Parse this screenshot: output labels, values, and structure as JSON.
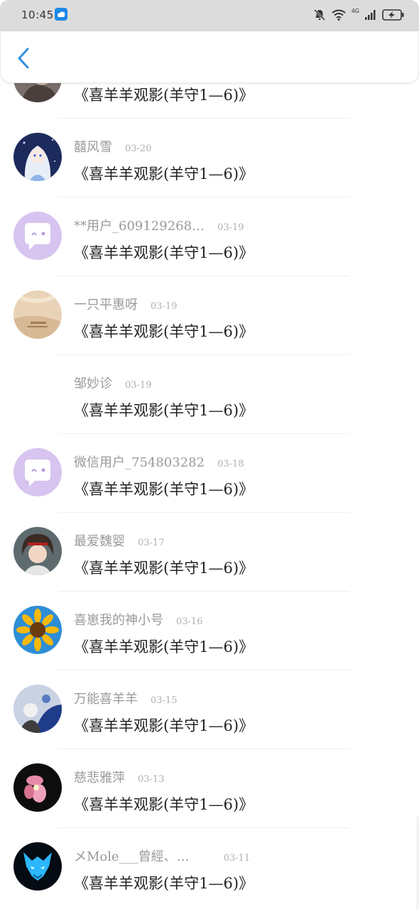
{
  "status_bar": {
    "time": "10:45",
    "network_label": "4G",
    "icons": [
      "app-notification-icon",
      "mute-bell-icon",
      "wifi-icon",
      "signal-icon",
      "battery-charging-icon"
    ]
  },
  "header": {
    "back_icon": "chevron-left-icon",
    "accent_color": "#2f8de4"
  },
  "rows": [
    {
      "name": "",
      "date": "",
      "title": "《喜羊羊观影(羊守1—6)》",
      "avatar": "photo-avatar"
    },
    {
      "name": "囍风雪",
      "date": "03-20",
      "title": "《喜羊羊观影(羊守1—6)》",
      "avatar": "anime-girl-avatar"
    },
    {
      "name": "**用户_609129268…",
      "date": "03-19",
      "title": "《喜羊羊观影(羊守1—6)》",
      "avatar": "default-chat-avatar"
    },
    {
      "name": "一只平惠呀",
      "date": "03-19",
      "title": "《喜羊羊观影(羊守1—6)》",
      "avatar": "illustration-avatar"
    },
    {
      "name": "邹妙诊",
      "date": "03-19",
      "title": "《喜羊羊观影(羊守1—6)》",
      "avatar": "none"
    },
    {
      "name": "微信用户_754803282",
      "date": "03-18",
      "title": "《喜羊羊观影(羊守1—6)》",
      "avatar": "default-chat-avatar"
    },
    {
      "name": "最爱魏婴",
      "date": "03-17",
      "title": "《喜羊羊观影(羊守1—6)》",
      "avatar": "anime-boy-avatar"
    },
    {
      "name": "喜崽我的神小号",
      "date": "03-16",
      "title": "《喜羊羊观影(羊守1—6)》",
      "avatar": "sunflower-avatar"
    },
    {
      "name": "万能喜羊羊",
      "date": "03-15",
      "title": "《喜羊羊观影(羊守1—6)》",
      "avatar": "cartoon-avatar"
    },
    {
      "name": "慈悲雅萍",
      "date": "03-13",
      "title": "《喜羊羊观影(羊守1—6)》",
      "avatar": "orchid-avatar"
    },
    {
      "name": "メMole___曾經、…",
      "date": "03-11",
      "title": "《喜羊羊观影(羊守1—6)》",
      "avatar": "blue-wolf-avatar"
    }
  ]
}
